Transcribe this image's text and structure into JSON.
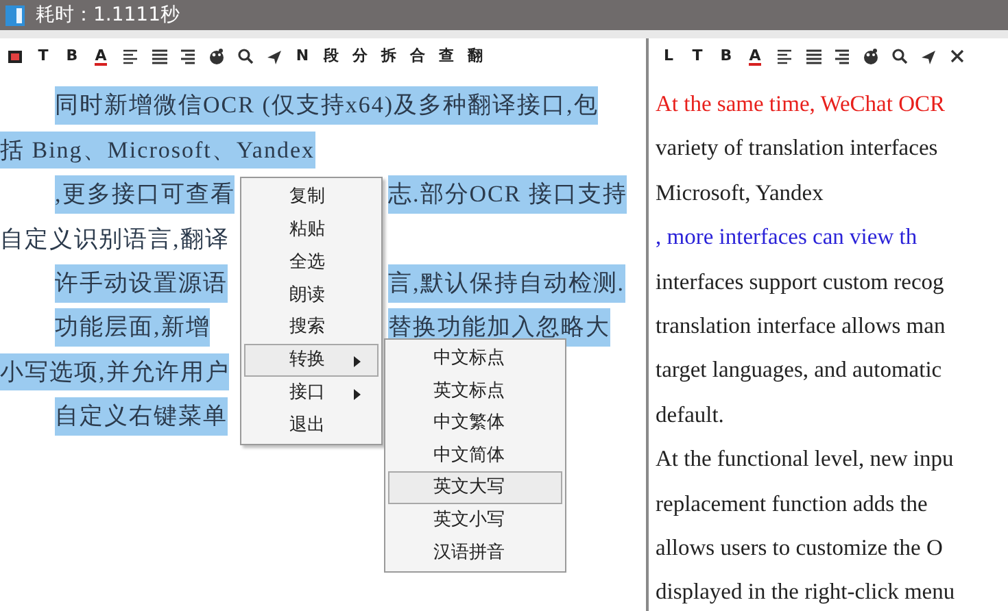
{
  "window": {
    "title": "耗时：1.1111秒"
  },
  "left_toolbar": [
    {
      "kind": "stop"
    },
    {
      "kind": "text",
      "text": "T"
    },
    {
      "kind": "text",
      "text": "B"
    },
    {
      "kind": "underline-text",
      "text": "A"
    },
    {
      "kind": "align-left"
    },
    {
      "kind": "justify"
    },
    {
      "kind": "align-right"
    },
    {
      "kind": "palette"
    },
    {
      "kind": "search"
    },
    {
      "kind": "send"
    },
    {
      "kind": "text",
      "text": "N"
    },
    {
      "kind": "text",
      "text": "段"
    },
    {
      "kind": "text",
      "text": "分"
    },
    {
      "kind": "text",
      "text": "拆"
    },
    {
      "kind": "text",
      "text": "合"
    },
    {
      "kind": "text",
      "text": "查"
    },
    {
      "kind": "text",
      "text": "翻"
    }
  ],
  "source_lines": [
    {
      "indent": true,
      "highlighted": true,
      "text": "同时新增微信OCR (仅支持x64)及多种翻译接口,包"
    },
    {
      "indent": false,
      "highlighted": true,
      "text": "括 Bing、Microsoft、Yandex"
    },
    {
      "indent": true,
      "highlighted": true,
      "text": ",更多接口可查看",
      "text_after_menu": "志.部分OCR 接口支持"
    },
    {
      "indent": false,
      "highlighted": false,
      "text": "自定义识别语言,翻译"
    },
    {
      "indent": true,
      "highlighted": true,
      "text": "许手动设置源语",
      "text_after_menu": "言,默认保持自动检测."
    },
    {
      "indent": true,
      "highlighted": true,
      "text": "功能层面,新增",
      "text_after_menu": "替换功能加入忽略大"
    },
    {
      "indent": false,
      "highlighted": true,
      "text": "小写选项,并允许用户"
    },
    {
      "indent": true,
      "highlighted": true,
      "text": "自定义右键菜单"
    }
  ],
  "context_menu": [
    {
      "label": "复制",
      "submenu": false,
      "selected": false
    },
    {
      "label": "粘贴",
      "submenu": false,
      "selected": false
    },
    {
      "label": "全选",
      "submenu": false,
      "selected": false
    },
    {
      "label": "朗读",
      "submenu": false,
      "selected": false
    },
    {
      "label": "搜索",
      "submenu": false,
      "selected": false
    },
    {
      "label": "转换",
      "submenu": true,
      "selected": true
    },
    {
      "label": "接口",
      "submenu": true,
      "selected": false
    },
    {
      "label": "退出",
      "submenu": false,
      "selected": false
    }
  ],
  "submenu": [
    {
      "label": "中文标点",
      "selected": false
    },
    {
      "label": "英文标点",
      "selected": false
    },
    {
      "label": "中文繁体",
      "selected": false
    },
    {
      "label": "中文简体",
      "selected": false
    },
    {
      "label": "英文大写",
      "selected": true
    },
    {
      "label": "英文小写",
      "selected": false
    },
    {
      "label": "汉语拼音",
      "selected": false
    }
  ],
  "right_toolbar": [
    {
      "kind": "text",
      "text": "L"
    },
    {
      "kind": "text",
      "text": "T"
    },
    {
      "kind": "text",
      "text": "B"
    },
    {
      "kind": "underline-text",
      "text": "A"
    },
    {
      "kind": "align-left"
    },
    {
      "kind": "justify"
    },
    {
      "kind": "align-right"
    },
    {
      "kind": "palette"
    },
    {
      "kind": "search"
    },
    {
      "kind": "send"
    },
    {
      "kind": "close"
    }
  ],
  "translation_lines": [
    {
      "color": "#e8201c",
      "text": "At the same time, WeChat OCR"
    },
    {
      "color": "#222222",
      "text": "variety of translation interfaces"
    },
    {
      "color": "#222222",
      "text": "Microsoft, Yandex"
    },
    {
      "color": "#2a22d8",
      "text": ", more interfaces can view th"
    },
    {
      "color": "#222222",
      "text": "interfaces support custom recog"
    },
    {
      "color": "#222222",
      "text": "translation interface allows man"
    },
    {
      "color": "#222222",
      "text": "target languages, and automatic"
    },
    {
      "color": "#222222",
      "text": "default."
    },
    {
      "color": "#222222",
      "text": "At the functional level, new inpu"
    },
    {
      "color": "#222222",
      "text": "replacement function adds the"
    },
    {
      "color": "#222222",
      "text": "allows users to customize the O"
    },
    {
      "color": "#222222",
      "text": "displayed in the right-click menu"
    }
  ]
}
